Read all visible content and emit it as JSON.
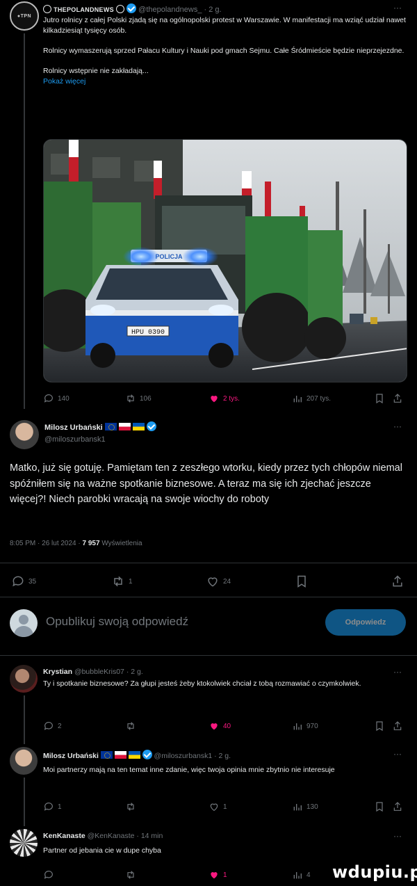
{
  "quoted_tweet": {
    "author_name": "THEPOLANDNEWS",
    "handle": "@thepolandnews_",
    "time": "· 2 g.",
    "more": "···",
    "para1": "Jutro rolnicy z całej Polski zjadą się na ogólnopolski protest w Warszawie. W manifestacji ma wziąć udział nawet kilkadziesiąt tysięcy osób.",
    "para2": "Rolnicy wymaszerują sprzed Pałacu Kultury i Nauki pod gmach Sejmu. Całe Śródmieście będzie nieprzejezdne.",
    "para3": "Rolnicy wstępnie nie zakładają...",
    "show_more": "Pokaż więcej",
    "image_plate": "HPU 0390",
    "image_police": "POLICJA",
    "stats": {
      "replies": "140",
      "retweets": "106",
      "likes": "2 tys.",
      "views": "207 tys."
    }
  },
  "main_tweet": {
    "author_name": "Milosz Urbański",
    "handle": "@miloszurbansk1",
    "more": "···",
    "text": "Matko, już się gotuję. Pamiętam ten z zeszłego wtorku, kiedy przez tych chłopów niemal spóźniłem się na ważne spotkanie biznesowe. A teraz ma się ich zjechać jeszcze więcej?! Niech parobki wracają na swoje wiochy do roboty",
    "meta_time": "8:05 PM · 26 lut 2024 · ",
    "meta_views": "7 957",
    "meta_views_label": " Wyświetlenia",
    "stats": {
      "replies": "35",
      "retweets": "1",
      "likes": "24"
    }
  },
  "reply_box": {
    "placeholder": "Opublikuj swoją odpowiedź",
    "button": "Odpowiedz"
  },
  "replies": [
    {
      "author_name": "Krystian",
      "handle": "@bubbleKris07",
      "time": "· 2 g.",
      "text": "Ty i spotkanie biznesowe? Za głupi jesteś żeby ktokolwiek chciał z tobą rozmawiać o czymkolwiek.",
      "stats": {
        "replies": "2",
        "retweets": "",
        "likes": "40",
        "views": "970"
      }
    },
    {
      "author_name": "Milosz Urbański",
      "handle": "@miloszurbansk1",
      "time": "· 2 g.",
      "text": "Moi partnerzy mają na ten temat inne zdanie, więc twoja opinia mnie zbytnio nie interesuje",
      "stats": {
        "replies": "1",
        "retweets": "",
        "likes": "1",
        "views": "130"
      }
    },
    {
      "author_name": "KenKanaste",
      "handle": "@KenKanaste",
      "time": "· 14 min",
      "text": "Partner od jebania cie w dupe chyba",
      "stats": {
        "replies": "",
        "retweets": "",
        "likes": "1",
        "views": "4"
      }
    }
  ],
  "watermark": "wdupiu.pl",
  "colors": {
    "accent": "#1d9bf0",
    "like": "#f91880",
    "muted": "#71767b"
  }
}
